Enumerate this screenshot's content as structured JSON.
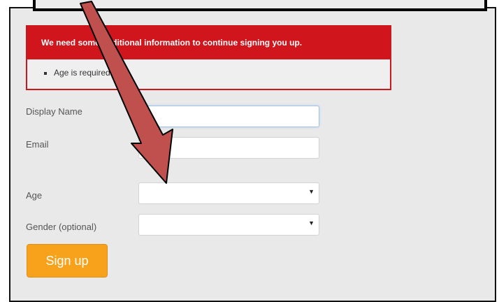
{
  "error": {
    "heading": "We need some additional information to continue signing you up.",
    "items": [
      "Age is required"
    ]
  },
  "form": {
    "display_name": {
      "label": "Display Name",
      "value": ""
    },
    "email": {
      "label": "Email",
      "value": ""
    },
    "age": {
      "label": "Age",
      "selected": ""
    },
    "gender": {
      "label": "Gender (optional)",
      "selected": ""
    },
    "signup_label": "Sign up"
  },
  "icons": {
    "callout_arrow": "red-arrow-icon",
    "select_arrow": "triangle-down-icon"
  },
  "colors": {
    "error_red": "#d0161c",
    "button_orange": "#f7a21a",
    "arrow_red": "#c0504d"
  }
}
